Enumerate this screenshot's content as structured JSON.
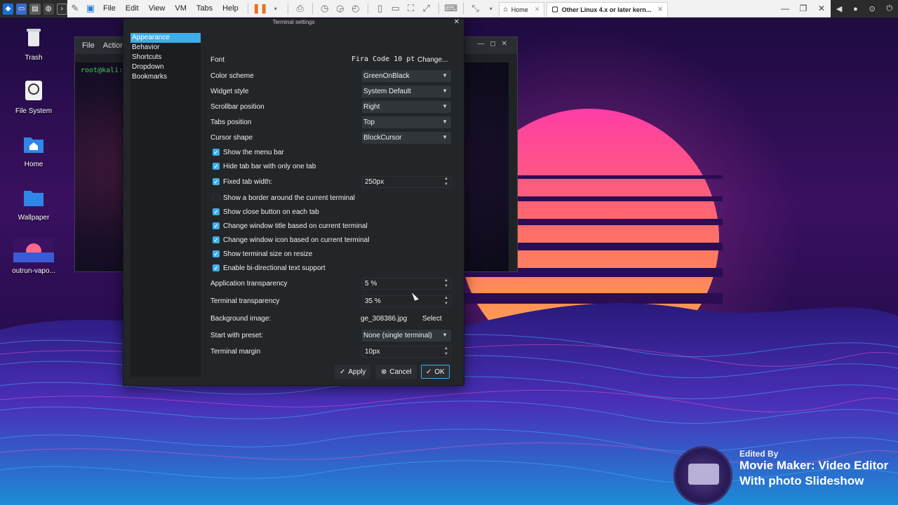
{
  "vm": {
    "menu": [
      "File",
      "Edit",
      "View",
      "VM",
      "Tabs",
      "Help"
    ],
    "tabs": [
      {
        "label": "Home"
      },
      {
        "label": "Other Linux 4.x or later kern..."
      }
    ]
  },
  "desktop": {
    "icons": [
      {
        "label": "Trash"
      },
      {
        "label": "File System"
      },
      {
        "label": "Home"
      },
      {
        "label": "Wallpaper"
      },
      {
        "label": "outrun-vapo..."
      }
    ]
  },
  "terminal": {
    "menu": [
      "File",
      "Actions"
    ],
    "prompt": "root@kali:~#"
  },
  "dialog": {
    "title": "Terminal settings",
    "nav": [
      "Appearance",
      "Behavior",
      "Shortcuts",
      "Dropdown",
      "Bookmarks"
    ],
    "font": {
      "label": "Font",
      "value": "Fira Code 10 pt",
      "button": "Change..."
    },
    "selects": {
      "color_scheme": {
        "label": "Color scheme",
        "value": "GreenOnBlack"
      },
      "widget_style": {
        "label": "Widget style",
        "value": "System Default"
      },
      "scrollbar_position": {
        "label": "Scrollbar position",
        "value": "Right"
      },
      "tabs_position": {
        "label": "Tabs position",
        "value": "Top"
      },
      "cursor_shape": {
        "label": "Cursor shape",
        "value": "BlockCursor"
      }
    },
    "checks": {
      "menu_bar": {
        "label": "Show the menu bar",
        "checked": true
      },
      "hide_tab_bar": {
        "label": "Hide tab bar with only one tab",
        "checked": true
      },
      "fixed_tab_width": {
        "label": "Fixed tab width:",
        "checked": true,
        "value": "250px"
      },
      "border": {
        "label": "Show a border around the current terminal",
        "checked": false
      },
      "close_button": {
        "label": "Show close button on each tab",
        "checked": true
      },
      "window_title": {
        "label": "Change window title based on current terminal",
        "checked": true
      },
      "window_icon": {
        "label": "Change window icon based on current terminal",
        "checked": true
      },
      "terminal_size": {
        "label": "Show terminal size on resize",
        "checked": true
      },
      "bidi": {
        "label": "Enable bi-directional text support",
        "checked": true
      }
    },
    "app_transparency": {
      "label": "Application transparency",
      "value": "5 %"
    },
    "term_transparency": {
      "label": "Terminal transparency",
      "value": "35 %"
    },
    "background_image": {
      "label": "Background image:",
      "value": "ge_308386.jpg",
      "button": "Select"
    },
    "preset": {
      "label": "Start with preset:",
      "value": "None (single terminal)"
    },
    "margin": {
      "label": "Terminal margin",
      "value": "10px"
    },
    "buttons": {
      "apply": "Apply",
      "cancel": "Cancel",
      "ok": "OK"
    }
  },
  "watermark": {
    "line1": "Edited By",
    "line2": "Movie Maker: Video Editor",
    "line3": "With photo Slideshow"
  },
  "colors": {
    "accent": "#3daee9",
    "dialog_bg": "#232629",
    "prompt": "#39d353"
  }
}
